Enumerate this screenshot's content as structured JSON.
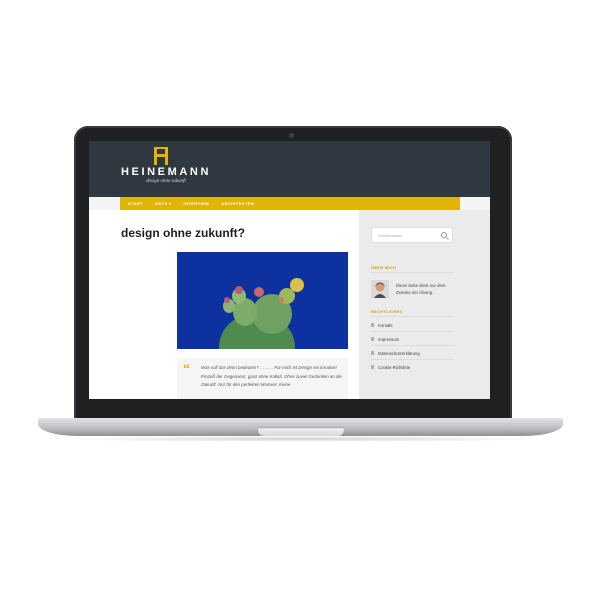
{
  "site": {
    "logo_text": "HEINEMANN",
    "tagline": "design ohne zukunft",
    "nav": [
      "START",
      "ARTS ▾",
      "INTERVIEW",
      "ARCHITEKTEN"
    ]
  },
  "post": {
    "title": "design ohne zukunft?",
    "quote_mark": "“",
    "quote": "Was soll das denn bedeuten? ……… Für mich ist Design ein kreativer Prozeß der Gegenwart, ganz ohne Kalkül. Ohne zuviel Gedanken an die Zukunft. Nur für den perfekten Moment. Keine"
  },
  "sidebar": {
    "search_placeholder": "Suchformular",
    "about_heading": "ÜBER MICH",
    "about_text": "Diese Seite dient nur dem Zwecke der Übung.",
    "legal_heading": "RECHTLICHES",
    "links": [
      "Kontakt",
      "Impressum",
      "Datenschutzerklärung",
      "Cookie-Richtlinie"
    ]
  },
  "colors": {
    "accent": "#e1b505",
    "header_bg": "#2f3840",
    "photo_bg": "#0d32a0"
  }
}
